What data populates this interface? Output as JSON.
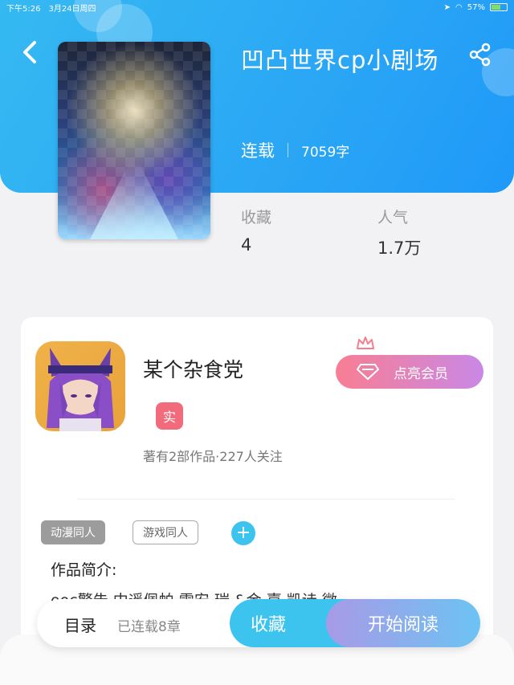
{
  "status_bar": {
    "time": "下午5:26",
    "date": "3月24日周四",
    "battery": "57%"
  },
  "book": {
    "title": "凹凸世界cp小剧场",
    "status": "连载",
    "word_count": "7059字",
    "stats": [
      {
        "label": "收藏",
        "value": "4"
      },
      {
        "label": "人气",
        "value": "1.7万"
      }
    ]
  },
  "author": {
    "name": "某个杂食党",
    "verified_badge": "实",
    "stats": "著有2部作品·227人关注",
    "vip_button": "点亮会员"
  },
  "tags": [
    "动漫同人",
    "游戏同人"
  ],
  "add_tag": "+",
  "intro": {
    "label": "作品简介:",
    "text": "ooc警告 中遥佩帕 雷安 瑞 &金 嘉 凯诗 微"
  },
  "bottom_bar": {
    "toc_label": "目录",
    "chapters_label": "已连载8章",
    "favorite_label": "收藏",
    "read_label": "开始阅读"
  },
  "colors": {
    "header_blue": "#2aa6f5",
    "accent_cyan": "#3cc4ef",
    "badge_red": "#f26b7c"
  }
}
